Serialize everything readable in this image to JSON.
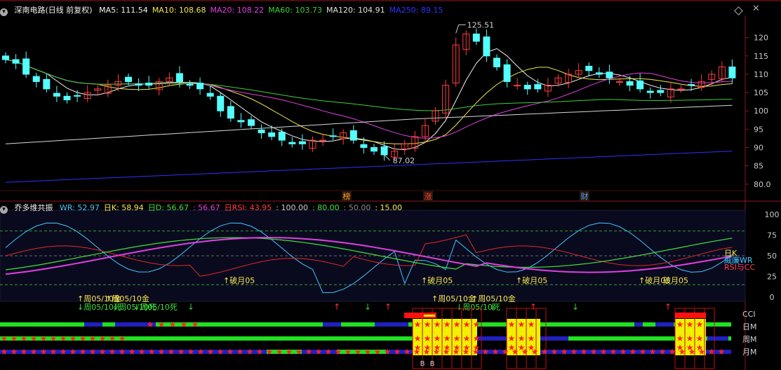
{
  "top_panel": {
    "stock_title": "深南电路(日线 前复权)",
    "indicators": [
      {
        "label": "MA5: 111.54",
        "color": "#f2f2f2"
      },
      {
        "label": "MA10: 108.68",
        "color": "#f5e74e"
      },
      {
        "label": "MA20: 108.22",
        "color": "#e040e0"
      },
      {
        "label": "MA60: 103.73",
        "color": "#3ad13a"
      },
      {
        "label": "MA120: 104.91",
        "color": "#e0e0e0"
      },
      {
        "label": "MA250: 89.15",
        "color": "#3030ff"
      }
    ],
    "price_axis": [
      "120",
      "115",
      "110",
      "105",
      "100",
      "95",
      "90",
      "85",
      "80.0"
    ],
    "annotations": {
      "high": "125.51",
      "low": "87.02"
    },
    "event_markers": [
      {
        "text": "榜",
        "color": "#ff9a2e"
      },
      {
        "text": "涨",
        "color": "#ff4040"
      },
      {
        "text": "财",
        "color": "#4aa0ff"
      }
    ]
  },
  "bottom_panel": {
    "title": "乔多维共振",
    "indicators": [
      {
        "label": "WR: 52.97",
        "color": "#40c8ff"
      },
      {
        "label": "日K: 58.94",
        "color": "#f5e74e"
      },
      {
        "label": "日D: 56.67",
        "color": "#40e040"
      },
      {
        "label": ": 56.67",
        "color": "#e040e0"
      },
      {
        "label": "日RSI: 43.95",
        "color": "#ff4040"
      },
      {
        "label": ": 100.00",
        "color": "#cccccc"
      },
      {
        "label": ": 80.00",
        "color": "#40e040"
      },
      {
        "label": ": 50.00",
        "color": "#888888"
      },
      {
        "label": ": 15.00",
        "color": "#f5e74e"
      }
    ],
    "axis": [
      "100",
      "75",
      "50",
      "25",
      "0"
    ],
    "right_labels": [
      {
        "text": "日K",
        "color": "#f5e74e"
      },
      {
        "text": "威廉WR",
        "color": "#40c8ff"
      },
      {
        "text": "RSI与CC",
        "color": "#ff4040"
      }
    ],
    "row_labels": [
      "CCI",
      "日M",
      "周M",
      "月M"
    ],
    "signal_labels": [
      {
        "text": "↑周05/10金",
        "color": "#f5e74e"
      },
      {
        "text": "↑周05/10金",
        "color": "#f5e74e"
      },
      {
        "text": "↓周05/10死",
        "color": "#40e040"
      },
      {
        "text": "↓周05/10死",
        "color": "#40e040"
      },
      {
        "text": "↓周05/10死",
        "color": "#40e040"
      },
      {
        "text": "↑破月05",
        "color": "#f5e74e"
      },
      {
        "text": "↑破月05",
        "color": "#f5e74e"
      },
      {
        "text": "↑周05/10金",
        "color": "#f5e74e"
      },
      {
        "text": "↑周05/10金",
        "color": "#f5e74e"
      },
      {
        "text": "↓周05/10死",
        "color": "#40e040"
      },
      {
        "text": "↑破月05",
        "color": "#f5e74e"
      },
      {
        "text": "↑破月05",
        "color": "#f5e74e"
      },
      {
        "text": "破月05",
        "color": "#f5e74e"
      }
    ],
    "bottom_letters": [
      "B",
      "B"
    ]
  }
}
